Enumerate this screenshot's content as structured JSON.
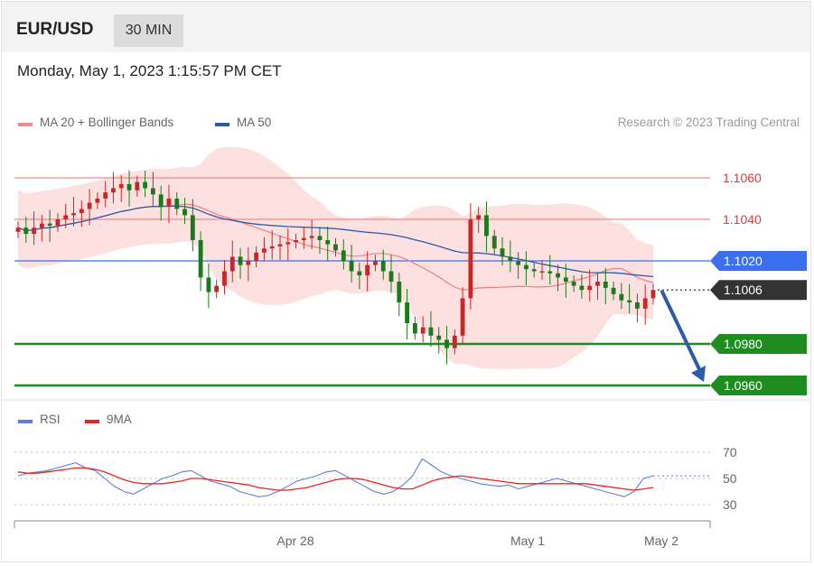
{
  "header": {
    "symbol": "EUR/USD",
    "timeframe": "30 MIN"
  },
  "datetime": "Monday, May 1, 2023 1:15:57 PM CET",
  "legend_main": [
    {
      "label": "MA 20 + Bollinger Bands",
      "color": "#f28b8b"
    },
    {
      "label": "MA 50",
      "color": "#2b5ca8"
    }
  ],
  "copyright": "Research © 2023 Trading Central",
  "legend_rsi": [
    {
      "label": "RSI",
      "color": "#5b7fe0"
    },
    {
      "label": "9MA",
      "color": "#ee2222"
    }
  ],
  "colors": {
    "resistance": "#f28b8b",
    "pivot": "#3b6ff0",
    "support": "#1f8c1f",
    "current": "#333333",
    "candle_up": "#c62828",
    "candle_down": "#1b7a1b",
    "band_fill": "#fde0e0",
    "arrow": "#2b5ca8"
  },
  "chart_data": [
    {
      "type": "candlestick",
      "title": "EUR/USD 30 MIN",
      "indicators": [
        "MA 20 + Bollinger Bands",
        "MA 50"
      ],
      "ylim": [
        1.0955,
        1.1075
      ],
      "x_tick_labels": [
        "Apr 28",
        "May 1",
        "May 2"
      ],
      "levels": [
        {
          "value": "1.1060",
          "kind": "resistance"
        },
        {
          "value": "1.1040",
          "kind": "resistance"
        },
        {
          "value": "1.1020",
          "kind": "pivot"
        },
        {
          "value": "1.1006",
          "kind": "current"
        },
        {
          "value": "1.0980",
          "kind": "support"
        },
        {
          "value": "1.0960",
          "kind": "support"
        }
      ],
      "forecast": {
        "from": 1.1006,
        "to": 1.096,
        "direction": "down"
      },
      "close": [
        1.1036,
        1.1033,
        1.1036,
        1.1038,
        1.1037,
        1.104,
        1.1042,
        1.1043,
        1.1045,
        1.1048,
        1.105,
        1.1053,
        1.1055,
        1.1057,
        1.1054,
        1.1058,
        1.1055,
        1.1052,
        1.1046,
        1.105,
        1.1045,
        1.1042,
        1.103,
        1.1012,
        1.1005,
        1.1008,
        1.1015,
        1.1022,
        1.1018,
        1.102,
        1.1024,
        1.1026,
        1.1027,
        1.1028,
        1.1029,
        1.103,
        1.1031,
        1.1032,
        1.103,
        1.1028,
        1.1025,
        1.102,
        1.1015,
        1.1013,
        1.1018,
        1.102,
        1.1015,
        1.101,
        1.1,
        1.099,
        1.0985,
        1.0988,
        1.0984,
        1.0982,
        1.0978,
        1.0984,
        1.1002,
        1.104,
        1.1042,
        1.1032,
        1.1026,
        1.1022,
        1.102,
        1.1018,
        1.1016,
        1.1015,
        1.1015,
        1.1014,
        1.1012,
        1.101,
        1.1008,
        1.1006,
        1.1008,
        1.101,
        1.1007,
        1.1004,
        1.1001,
        1.1,
        1.0997,
        1.1002,
        1.1006
      ],
      "rsi": [
        52,
        54,
        55,
        56,
        58,
        60,
        62,
        58,
        56,
        50,
        44,
        40,
        38,
        42,
        46,
        50,
        52,
        55,
        56,
        52,
        48,
        46,
        44,
        40,
        38,
        36,
        37,
        40,
        44,
        48,
        50,
        52,
        55,
        56,
        52,
        48,
        44,
        40,
        38,
        40,
        45,
        52,
        65,
        60,
        55,
        52,
        50,
        48,
        46,
        45,
        44,
        45,
        42,
        44,
        46,
        48,
        50,
        48,
        46,
        44,
        42,
        40,
        38,
        36,
        40,
        50,
        52
      ],
      "rsi_ma9": [
        55,
        54,
        54,
        55,
        56,
        57,
        58,
        58,
        57,
        55,
        52,
        49,
        47,
        46,
        46,
        46,
        47,
        48,
        50,
        50,
        49,
        48,
        47,
        46,
        45,
        43,
        42,
        41,
        41,
        42,
        43,
        45,
        47,
        49,
        50,
        50,
        49,
        47,
        45,
        43,
        42,
        42,
        45,
        48,
        50,
        51,
        52,
        51,
        50,
        49,
        48,
        47,
        46,
        46,
        46,
        46,
        46,
        46,
        46,
        46,
        45,
        44,
        43,
        42,
        41,
        42,
        43
      ],
      "rsi_ylim": [
        20,
        80
      ],
      "rsi_ticks": [
        "70",
        "50",
        "30"
      ]
    }
  ]
}
